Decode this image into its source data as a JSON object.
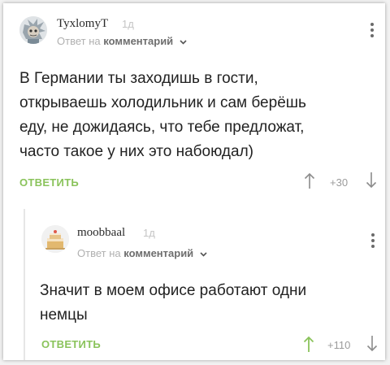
{
  "comments": [
    {
      "avatar_icon": "rick-avatar-icon",
      "username": "TyxlomyT",
      "time": "1д",
      "reply_prefix": "Ответ на",
      "reply_target": "комментарий",
      "text": "В Германии ты заходишь в гости,\nоткрываешь холодильник и сам берёшь\nеду, не дожидаясь, что тебе предложат,\nчасто такое у них это набоюдал)",
      "reply_label": "ОТВЕТИТЬ",
      "score": "+30",
      "upvote_color": "#8c8c8c"
    },
    {
      "avatar_icon": "cake-avatar-icon",
      "username": "moobbaal",
      "time": "1д",
      "reply_prefix": "Ответ на",
      "reply_target": "комментарий",
      "text": "Значит в моем офисе работают одни\nнемцы",
      "reply_label": "ОТВЕТИТЬ",
      "score": "+110",
      "upvote_color": "#8ac35b"
    }
  ],
  "colors": {
    "accent_green": "#8ac35b",
    "text": "#222222",
    "muted": "#b0b0b0"
  }
}
